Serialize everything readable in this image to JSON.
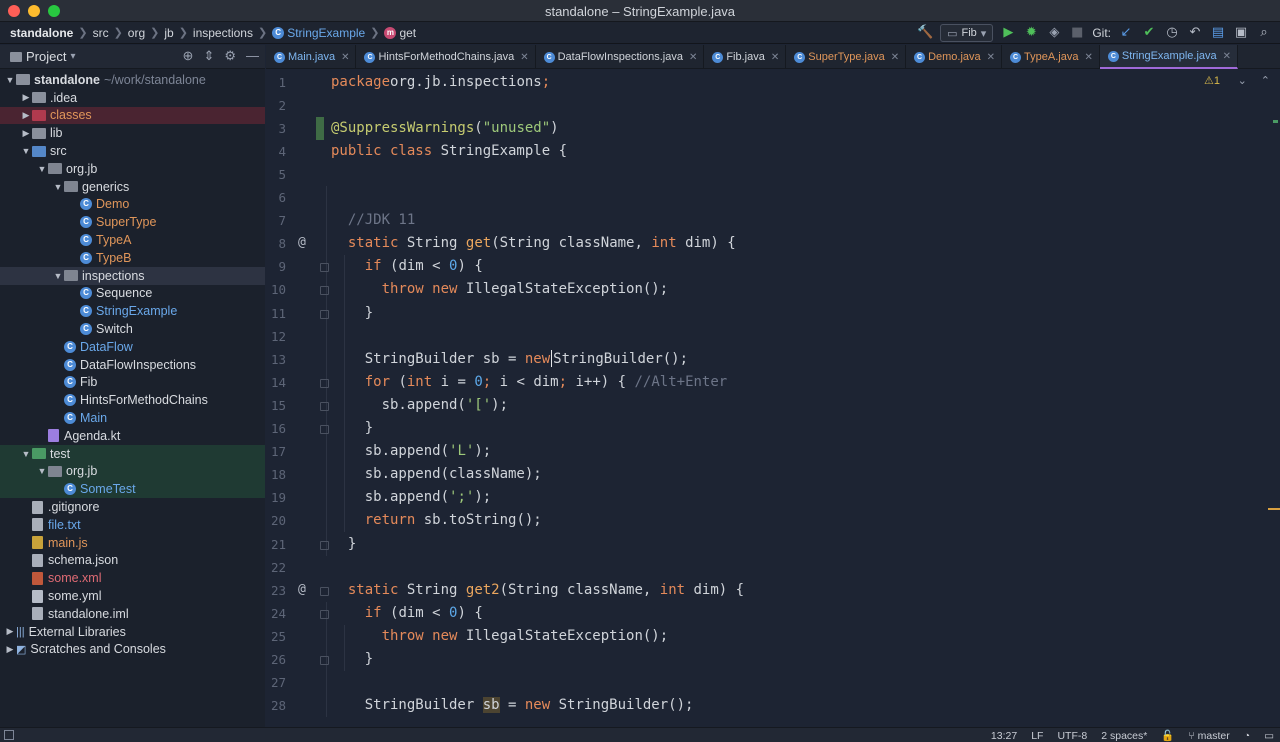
{
  "window": {
    "title": "standalone – StringExample.java"
  },
  "breadcrumbs": [
    "standalone",
    "src",
    "org",
    "jb",
    "inspections",
    "StringExample",
    "get"
  ],
  "toolbar": {
    "run_config": "Fib",
    "git_label": "Git:"
  },
  "project_panel": {
    "title": "Project",
    "tree": [
      {
        "label": "standalone",
        "hint": "~/work/standalone",
        "depth": 0,
        "arrow": "open",
        "icon": "folder",
        "style": "bold"
      },
      {
        "label": ".idea",
        "depth": 1,
        "arrow": "closed",
        "icon": "folder"
      },
      {
        "label": "classes",
        "depth": 1,
        "arrow": "closed",
        "icon": "folder-red",
        "style": "orange",
        "row": "hl-red"
      },
      {
        "label": "lib",
        "depth": 1,
        "arrow": "closed",
        "icon": "folder"
      },
      {
        "label": "src",
        "depth": 1,
        "arrow": "open",
        "icon": "folder-blue"
      },
      {
        "label": "org.jb",
        "depth": 2,
        "arrow": "open",
        "icon": "pkg"
      },
      {
        "label": "generics",
        "depth": 3,
        "arrow": "open",
        "icon": "pkg"
      },
      {
        "label": "Demo",
        "depth": 4,
        "icon": "class",
        "style": "orange"
      },
      {
        "label": "SuperType",
        "depth": 4,
        "icon": "class",
        "style": "orange"
      },
      {
        "label": "TypeA",
        "depth": 4,
        "icon": "class",
        "style": "orange"
      },
      {
        "label": "TypeB",
        "depth": 4,
        "icon": "class",
        "style": "orange"
      },
      {
        "label": "inspections",
        "depth": 3,
        "arrow": "open",
        "icon": "pkg",
        "row": "hl-sel"
      },
      {
        "label": "Sequence",
        "depth": 4,
        "icon": "class"
      },
      {
        "label": "StringExample",
        "depth": 4,
        "icon": "class",
        "style": "blue"
      },
      {
        "label": "Switch",
        "depth": 4,
        "icon": "class"
      },
      {
        "label": "DataFlow",
        "depth": 3,
        "icon": "class",
        "style": "blue"
      },
      {
        "label": "DataFlowInspections",
        "depth": 3,
        "icon": "class"
      },
      {
        "label": "Fib",
        "depth": 3,
        "icon": "class"
      },
      {
        "label": "HintsForMethodChains",
        "depth": 3,
        "icon": "class"
      },
      {
        "label": "Main",
        "depth": 3,
        "icon": "class",
        "style": "blue"
      },
      {
        "label": "Agenda.kt",
        "depth": 2,
        "icon": "kt"
      },
      {
        "label": "test",
        "depth": 1,
        "arrow": "open",
        "icon": "folder-green",
        "row": "hl-green"
      },
      {
        "label": "org.jb",
        "depth": 2,
        "arrow": "open",
        "icon": "pkg",
        "row": "hl-green"
      },
      {
        "label": "SomeTest",
        "depth": 3,
        "icon": "class",
        "style": "blue",
        "row": "hl-green"
      },
      {
        "label": ".gitignore",
        "depth": 1,
        "icon": "file"
      },
      {
        "label": "file.txt",
        "depth": 1,
        "icon": "file",
        "style": "blue"
      },
      {
        "label": "main.js",
        "depth": 1,
        "icon": "js",
        "style": "orange"
      },
      {
        "label": "schema.json",
        "depth": 1,
        "icon": "file"
      },
      {
        "label": "some.xml",
        "depth": 1,
        "icon": "xml",
        "style": "red"
      },
      {
        "label": "some.yml",
        "depth": 1,
        "icon": "yml"
      },
      {
        "label": "standalone.iml",
        "depth": 1,
        "icon": "file"
      },
      {
        "label": "External Libraries",
        "depth": 0,
        "arrow": "closed",
        "icon": "lib"
      },
      {
        "label": "Scratches and Consoles",
        "depth": 0,
        "arrow": "closed",
        "icon": "scratch"
      }
    ]
  },
  "tabs": [
    {
      "label": "Main.java",
      "style": "blue"
    },
    {
      "label": "HintsForMethodChains.java",
      "style": ""
    },
    {
      "label": "DataFlowInspections.java",
      "style": ""
    },
    {
      "label": "Fib.java",
      "style": ""
    },
    {
      "label": "SuperType.java",
      "style": "orange"
    },
    {
      "label": "Demo.java",
      "style": "orange"
    },
    {
      "label": "TypeA.java",
      "style": "orange"
    },
    {
      "label": "StringExample.java",
      "style": "blue",
      "active": true
    }
  ],
  "editor": {
    "warnings": "1",
    "lines": [
      {
        "n": "1",
        "code": [
          [
            "kw",
            "package"
          ],
          [
            "",
            "org.jb.inspections"
          ],
          [
            "kw",
            ";"
          ]
        ]
      },
      {
        "n": "2",
        "code": []
      },
      {
        "n": "3",
        "code": [
          [
            "ann",
            "@SuppressWarnings"
          ],
          [
            "",
            "("
          ],
          [
            "str",
            "\"unused\""
          ],
          [
            "",
            ")"
          ]
        ],
        "change": true
      },
      {
        "n": "4",
        "code": [
          [
            "kw",
            "public class "
          ],
          [
            "",
            "StringExample {"
          ]
        ]
      },
      {
        "n": "5",
        "code": []
      },
      {
        "n": "6",
        "code": []
      },
      {
        "n": "7",
        "code": [
          [
            "",
            "  "
          ],
          [
            "cm",
            "//JDK 11"
          ]
        ]
      },
      {
        "n": "8",
        "code": [
          [
            "",
            "  "
          ],
          [
            "kw",
            "static "
          ],
          [
            "",
            "String "
          ],
          [
            "fn",
            "get"
          ],
          [
            "",
            "(String className, "
          ],
          [
            "kw",
            "int "
          ],
          [
            "",
            "dim) {"
          ]
        ],
        "at": true
      },
      {
        "n": "9",
        "code": [
          [
            "",
            "    "
          ],
          [
            "kw",
            "if "
          ],
          [
            "",
            "(dim < "
          ],
          [
            "num",
            "0"
          ],
          [
            "",
            ") {"
          ]
        ]
      },
      {
        "n": "10",
        "code": [
          [
            "",
            "      "
          ],
          [
            "kw",
            "throw new "
          ],
          [
            "",
            "IllegalStateException();"
          ]
        ]
      },
      {
        "n": "11",
        "code": [
          [
            "",
            "    }"
          ]
        ]
      },
      {
        "n": "12",
        "code": []
      },
      {
        "n": "13",
        "code": [
          [
            "",
            "    StringBuilder sb = "
          ],
          [
            "kw",
            "new"
          ],
          [
            "cursor",
            ""
          ],
          [
            "",
            "StringBuilder();"
          ]
        ]
      },
      {
        "n": "14",
        "code": [
          [
            "",
            "    "
          ],
          [
            "kw",
            "for "
          ],
          [
            "",
            "("
          ],
          [
            "kw",
            "int "
          ],
          [
            "",
            "i = "
          ],
          [
            "num",
            "0"
          ],
          [
            "kw",
            "; "
          ],
          [
            "",
            "i < dim"
          ],
          [
            "kw",
            "; "
          ],
          [
            "",
            "i++) { "
          ],
          [
            "cm",
            "//Alt+Enter"
          ]
        ]
      },
      {
        "n": "15",
        "code": [
          [
            "",
            "      sb.append("
          ],
          [
            "str",
            "'['"
          ],
          [
            "",
            ");"
          ]
        ]
      },
      {
        "n": "16",
        "code": [
          [
            "",
            "    }"
          ]
        ]
      },
      {
        "n": "17",
        "code": [
          [
            "",
            "    sb.append("
          ],
          [
            "str",
            "'L'"
          ],
          [
            "",
            ");"
          ]
        ]
      },
      {
        "n": "18",
        "code": [
          [
            "",
            "    sb.append(className);"
          ]
        ]
      },
      {
        "n": "19",
        "code": [
          [
            "",
            "    sb.append("
          ],
          [
            "str",
            "';'"
          ],
          [
            "",
            ");"
          ]
        ]
      },
      {
        "n": "20",
        "code": [
          [
            "",
            "    "
          ],
          [
            "kw",
            "return "
          ],
          [
            "",
            "sb.toString();"
          ]
        ]
      },
      {
        "n": "21",
        "code": [
          [
            "",
            "  }"
          ]
        ]
      },
      {
        "n": "22",
        "code": []
      },
      {
        "n": "23",
        "code": [
          [
            "",
            "  "
          ],
          [
            "kw",
            "static "
          ],
          [
            "",
            "String "
          ],
          [
            "fn",
            "get2"
          ],
          [
            "",
            "(String className, "
          ],
          [
            "kw",
            "int "
          ],
          [
            "",
            "dim) {"
          ]
        ],
        "at": true
      },
      {
        "n": "24",
        "code": [
          [
            "",
            "    "
          ],
          [
            "kw",
            "if "
          ],
          [
            "",
            "(dim < "
          ],
          [
            "num",
            "0"
          ],
          [
            "",
            ") {"
          ]
        ]
      },
      {
        "n": "25",
        "code": [
          [
            "",
            "      "
          ],
          [
            "kw",
            "throw new "
          ],
          [
            "",
            "IllegalStateException();"
          ]
        ]
      },
      {
        "n": "26",
        "code": [
          [
            "",
            "    }"
          ]
        ]
      },
      {
        "n": "27",
        "code": []
      },
      {
        "n": "28",
        "code": [
          [
            "",
            "    StringBuilder "
          ],
          [
            "hl",
            "sb"
          ],
          [
            "",
            " = "
          ],
          [
            "kw",
            "new "
          ],
          [
            "",
            "StringBuilder();"
          ]
        ]
      }
    ]
  },
  "status": {
    "position": "13:27",
    "line_sep": "LF",
    "encoding": "UTF-8",
    "indent": "2 spaces*",
    "branch": "master"
  }
}
